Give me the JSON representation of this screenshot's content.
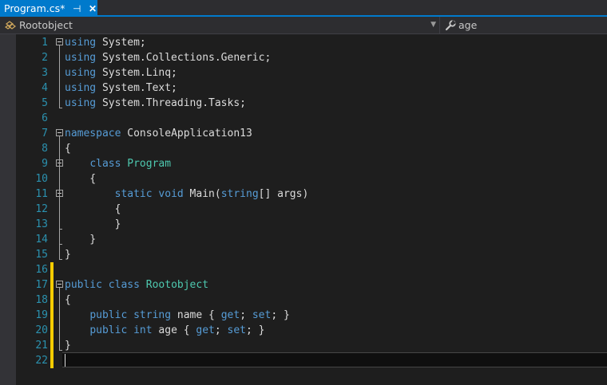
{
  "tab": {
    "title": "Program.cs*",
    "pin_glyph": "⊣",
    "close_glyph": "✕"
  },
  "nav": {
    "left_label": "Rootobject",
    "right_label": "age"
  },
  "code_lines": [
    [
      {
        "t": "using",
        "c": "kw"
      },
      {
        "t": " System;",
        "c": "pl"
      }
    ],
    [
      {
        "t": "using",
        "c": "kw"
      },
      {
        "t": " System.Collections.Generic;",
        "c": "pl"
      }
    ],
    [
      {
        "t": "using",
        "c": "kw"
      },
      {
        "t": " System.Linq;",
        "c": "pl"
      }
    ],
    [
      {
        "t": "using",
        "c": "kw"
      },
      {
        "t": " System.Text;",
        "c": "pl"
      }
    ],
    [
      {
        "t": "using",
        "c": "kw"
      },
      {
        "t": " System.Threading.Tasks;",
        "c": "pl"
      }
    ],
    [],
    [
      {
        "t": "namespace",
        "c": "kw"
      },
      {
        "t": " ConsoleApplication13",
        "c": "pl"
      }
    ],
    [
      {
        "t": "{",
        "c": "pl"
      }
    ],
    [
      {
        "t": "    ",
        "c": "pl"
      },
      {
        "t": "class",
        "c": "kw"
      },
      {
        "t": " ",
        "c": "pl"
      },
      {
        "t": "Program",
        "c": "ty"
      }
    ],
    [
      {
        "t": "    {",
        "c": "pl"
      }
    ],
    [
      {
        "t": "        ",
        "c": "pl"
      },
      {
        "t": "static",
        "c": "kw"
      },
      {
        "t": " ",
        "c": "pl"
      },
      {
        "t": "void",
        "c": "kw"
      },
      {
        "t": " Main(",
        "c": "pl"
      },
      {
        "t": "string",
        "c": "kw"
      },
      {
        "t": "[] args)",
        "c": "pl"
      }
    ],
    [
      {
        "t": "        {",
        "c": "pl"
      }
    ],
    [
      {
        "t": "        }",
        "c": "pl"
      }
    ],
    [
      {
        "t": "    }",
        "c": "pl"
      }
    ],
    [
      {
        "t": "}",
        "c": "pl"
      }
    ],
    [],
    [
      {
        "t": "public",
        "c": "kw"
      },
      {
        "t": " ",
        "c": "pl"
      },
      {
        "t": "class",
        "c": "kw"
      },
      {
        "t": " ",
        "c": "pl"
      },
      {
        "t": "Rootobject",
        "c": "ty"
      }
    ],
    [
      {
        "t": "{",
        "c": "pl"
      }
    ],
    [
      {
        "t": "    ",
        "c": "pl"
      },
      {
        "t": "public",
        "c": "kw"
      },
      {
        "t": " ",
        "c": "pl"
      },
      {
        "t": "string",
        "c": "kw"
      },
      {
        "t": " name { ",
        "c": "pl"
      },
      {
        "t": "get",
        "c": "kw"
      },
      {
        "t": "; ",
        "c": "pl"
      },
      {
        "t": "set",
        "c": "kw"
      },
      {
        "t": "; }",
        "c": "pl"
      }
    ],
    [
      {
        "t": "    ",
        "c": "pl"
      },
      {
        "t": "public",
        "c": "kw"
      },
      {
        "t": " ",
        "c": "pl"
      },
      {
        "t": "int",
        "c": "kw"
      },
      {
        "t": " age { ",
        "c": "pl"
      },
      {
        "t": "get",
        "c": "kw"
      },
      {
        "t": "; ",
        "c": "pl"
      },
      {
        "t": "set",
        "c": "kw"
      },
      {
        "t": "; }",
        "c": "pl"
      }
    ],
    [
      {
        "t": "}",
        "c": "pl"
      }
    ],
    []
  ],
  "line_numbers": [
    "1",
    "2",
    "3",
    "4",
    "5",
    "6",
    "7",
    "8",
    "9",
    "10",
    "11",
    "12",
    "13",
    "14",
    "15",
    "16",
    "17",
    "18",
    "19",
    "20",
    "21",
    "22"
  ],
  "fold_starts": [
    1,
    7,
    9,
    11,
    17
  ],
  "changed_lines": [
    16,
    17,
    18,
    19,
    20,
    21,
    22
  ],
  "current_line": 22,
  "colors": {
    "keyword": "#569cd6",
    "type": "#4ec9b0",
    "line_number": "#2b91af",
    "change_bar": "#f5cc00",
    "accent": "#007acc"
  }
}
